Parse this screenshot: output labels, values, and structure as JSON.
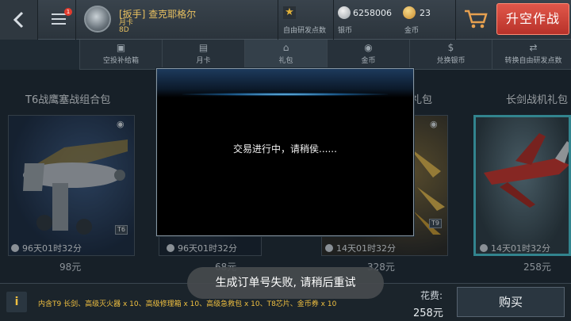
{
  "header": {
    "player_name": "[扳手] 查克耶格尔",
    "player_sub1": "月卡",
    "player_sub2": "8D",
    "research": {
      "label": "自由研发点数",
      "icon": "star-icon"
    },
    "silver": {
      "value": "6258006",
      "label": "银币",
      "icon": "silver-coin-icon"
    },
    "gold": {
      "value": "23",
      "label": "金币",
      "icon": "gold-coin-icon"
    },
    "cart_icon": "cart-icon",
    "fly_button": "升空作战",
    "menu_badge": "1"
  },
  "tabs": [
    {
      "label": "空投补给箱",
      "icon": "supply-box-icon"
    },
    {
      "label": "月卡",
      "icon": "card-icon"
    },
    {
      "label": "礼包",
      "icon": "gift-icon",
      "active": true
    },
    {
      "label": "金币",
      "icon": "gold-icon"
    },
    {
      "label": "兑换银币",
      "icon": "exchange-silver-icon"
    },
    {
      "label": "转换自由研发点数",
      "icon": "convert-icon"
    }
  ],
  "cards": [
    {
      "title": "T6战鹰塞战组合包",
      "timer": "96天01时32分",
      "price": "98元",
      "tier": "T6"
    },
    {
      "title": "",
      "timer": "96天01时32分",
      "price": "68元"
    },
    {
      "title": "礼包",
      "timer": "14天01时32分",
      "price": "328元",
      "tier": "T9"
    },
    {
      "title": "长剑战机礼包",
      "timer": "14天01时32分",
      "price": "258元"
    }
  ],
  "footer": {
    "info_icon": "info-icon",
    "contents": "内含T9 长剑、高级灭火器 x 10、高级修理箱 x 10、高级急救包 x 10、T8芯片、金币券 x 10",
    "cost_label": "花费:",
    "cost_value": "258元",
    "buy_button": "购买"
  },
  "modal": {
    "message": "交易进行中，请稍侯......"
  },
  "toast": {
    "message": "生成订单号失败, 请稍后重试"
  },
  "colors": {
    "accent": "#49c4d0",
    "fly_button": "#d2463a",
    "gold_text": "#f0c040"
  }
}
